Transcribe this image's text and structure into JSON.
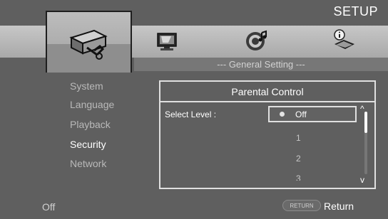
{
  "header": {
    "title": "SETUP"
  },
  "tabs": [
    {
      "icon": "toolbox-icon",
      "selected": true
    },
    {
      "icon": "monitor-pencil-icon",
      "selected": false
    },
    {
      "icon": "speaker-music-icon",
      "selected": false
    },
    {
      "icon": "info-book-icon",
      "selected": false
    }
  ],
  "sub_header": {
    "title": "--- General Setting ---"
  },
  "menu": {
    "items": [
      {
        "label": "System",
        "active": false
      },
      {
        "label": "Language",
        "active": false
      },
      {
        "label": "Playback",
        "active": false
      },
      {
        "label": "Security",
        "active": true
      },
      {
        "label": "Network",
        "active": false
      }
    ]
  },
  "panel": {
    "title": "Parental Control",
    "select_label": "Select Level :",
    "options": [
      "Off",
      "1",
      "2",
      "3"
    ],
    "selected_option": "Off"
  },
  "footer": {
    "status": "Off",
    "return_button": "RETURN",
    "return_label": "Return"
  },
  "colors": {
    "background": "#5f5f5f",
    "band": "#b8b8b8",
    "text_active": "#ffffff",
    "text_inactive": "#b9b9b9"
  }
}
